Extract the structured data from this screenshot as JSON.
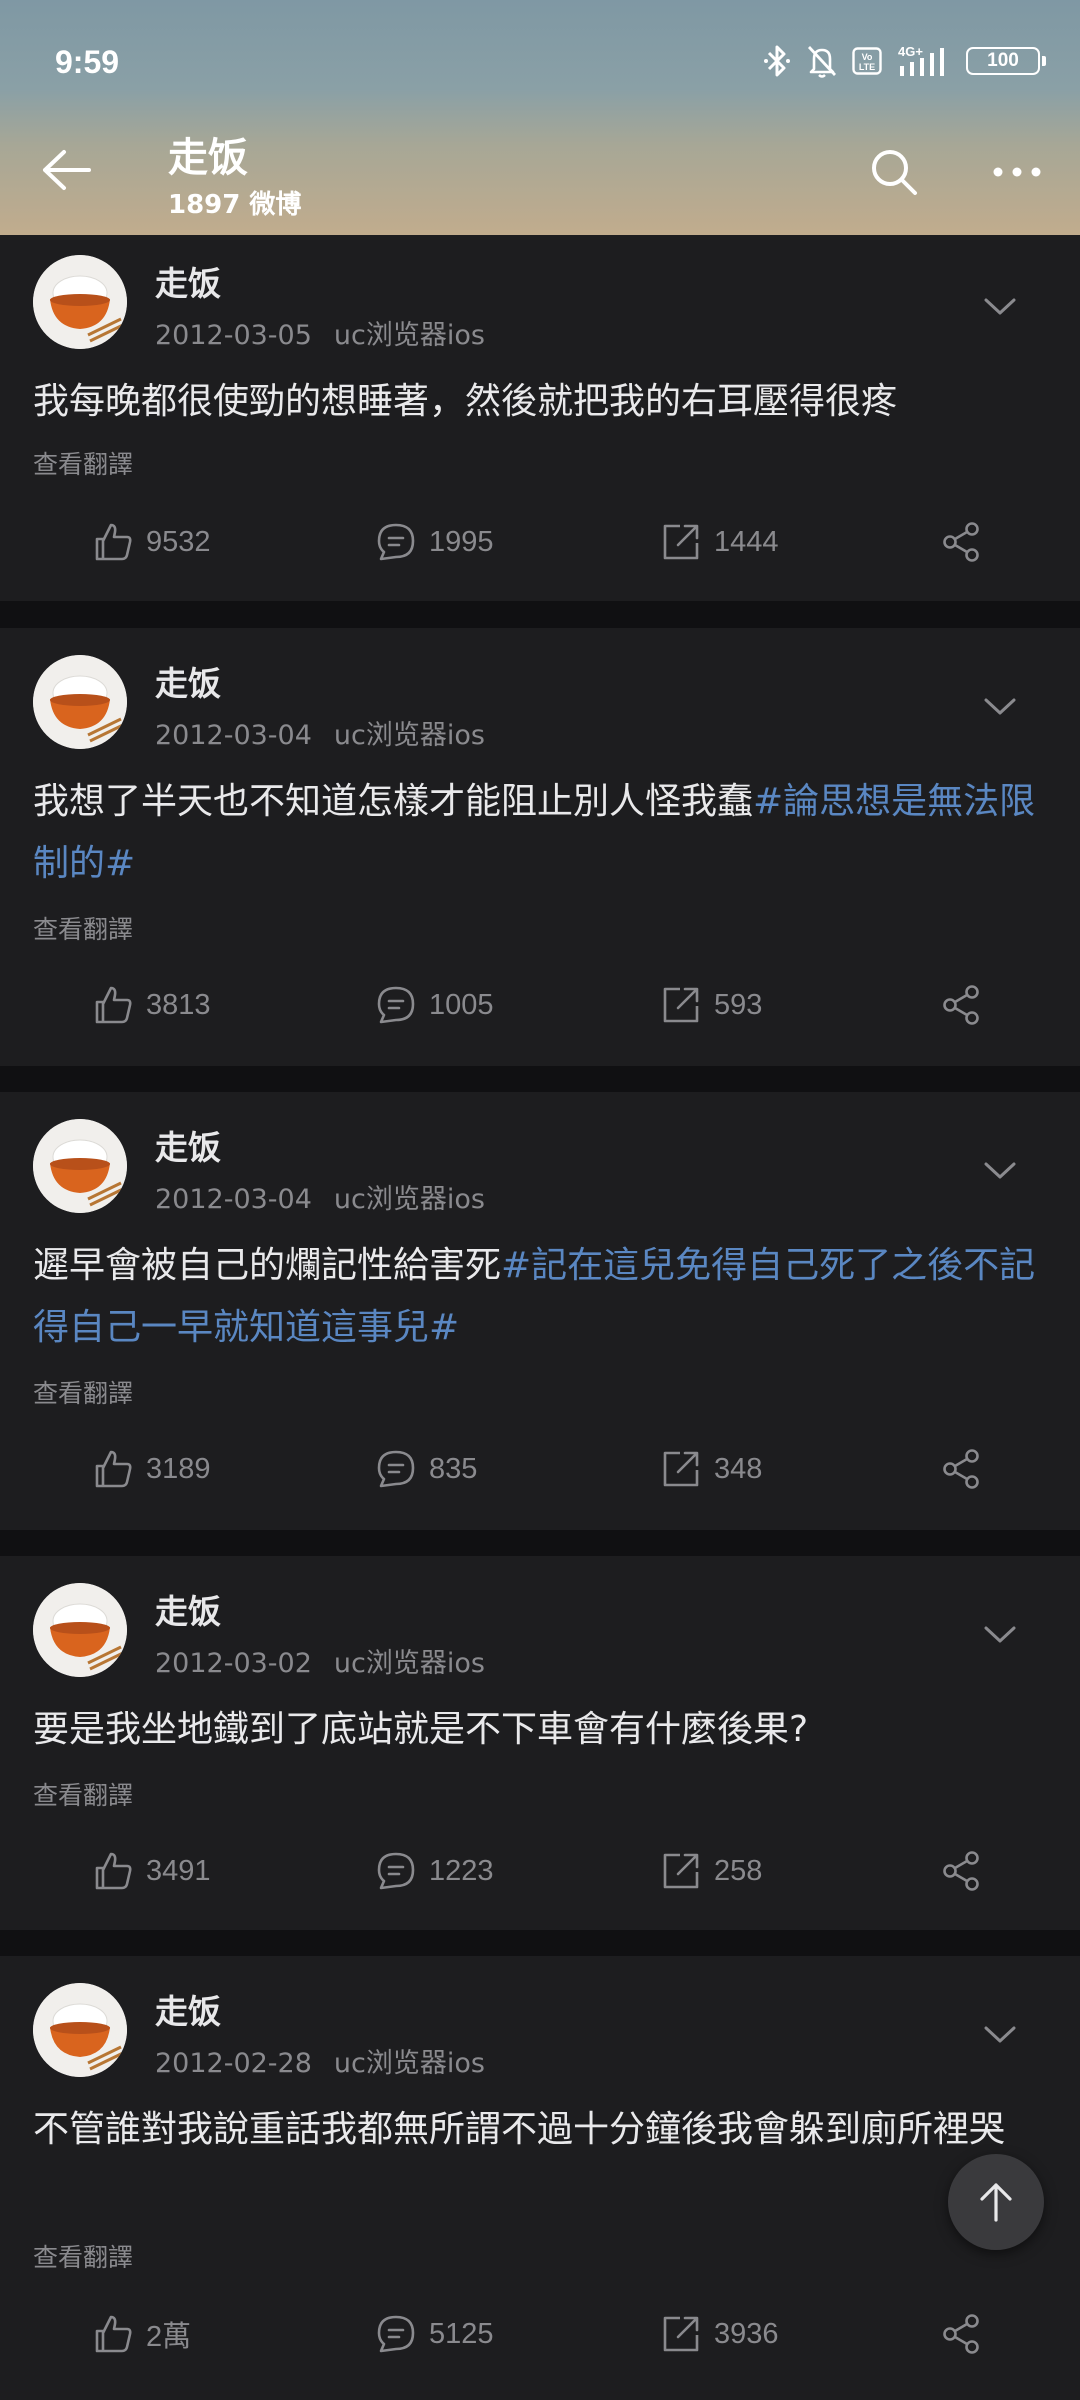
{
  "status_bar": {
    "time": "9:59",
    "network": "4G+",
    "volte": "VoLTE",
    "battery": "100"
  },
  "nav": {
    "title": "走饭",
    "subtitle": "1897 微博"
  },
  "posts": [
    {
      "author": "走饭",
      "date": "2012-03-05",
      "source": "uc浏览器ios",
      "text": "我每晚都很使勁的想睡著，然後就把我的右耳壓得很疼",
      "hashtag": "",
      "translate": "查看翻譯",
      "likes": "9532",
      "comments": "1995",
      "reposts": "1444"
    },
    {
      "author": "走饭",
      "date": "2012-03-04",
      "source": "uc浏览器ios",
      "text": "我想了半天也不知道怎樣才能阻止別人怪我蠢",
      "hashtag": "#論思想是無法限制的#",
      "translate": "查看翻譯",
      "likes": "3813",
      "comments": "1005",
      "reposts": "593"
    },
    {
      "author": "走饭",
      "date": "2012-03-04",
      "source": "uc浏览器ios",
      "text": "遲早會被自己的爛記性給害死",
      "hashtag": "#記在這兒免得自己死了之後不記得自己一早就知道這事兒#",
      "translate": "查看翻譯",
      "likes": "3189",
      "comments": "835",
      "reposts": "348"
    },
    {
      "author": "走饭",
      "date": "2012-03-02",
      "source": "uc浏览器ios",
      "text": "要是我坐地鐵到了底站就是不下車會有什麼後果?",
      "hashtag": "",
      "translate": "查看翻譯",
      "likes": "3491",
      "comments": "1223",
      "reposts": "258"
    },
    {
      "author": "走饭",
      "date": "2012-02-28",
      "source": "uc浏览器ios",
      "text": "不管誰對我說重話我都無所謂不過十分鐘後我會躲到廁所裡哭",
      "hashtag": "",
      "translate": "查看翻譯",
      "likes": "2萬",
      "comments": "5125",
      "reposts": "3936"
    }
  ],
  "colors": {
    "background": "#101012",
    "card": "#1d1d1f",
    "hashtag": "#5a87c2",
    "secondary_text": "#8a8a8e"
  }
}
